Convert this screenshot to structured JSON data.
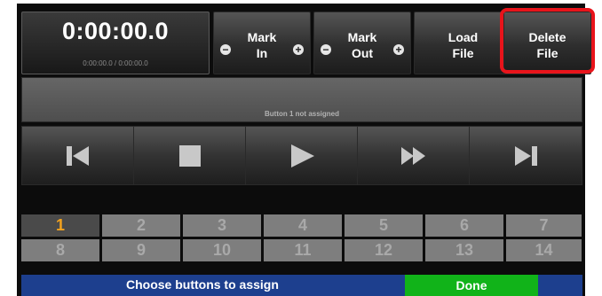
{
  "timer": {
    "main": "0:00:00.0",
    "sub": "0:00:00.0 / 0:00:00.0"
  },
  "buttons": {
    "mark_in": {
      "line1": "Mark",
      "line2": "In"
    },
    "mark_out": {
      "line1": "Mark",
      "line2": "Out"
    },
    "load_file": {
      "line1": "Load",
      "line2": "File"
    },
    "delete_file": {
      "line1": "Delete",
      "line2": "File"
    }
  },
  "assign_bar": {
    "text": "Button 1 not assigned"
  },
  "transport": [
    "skip-back-icon",
    "stop-icon",
    "play-icon",
    "fast-forward-icon",
    "skip-forward-icon"
  ],
  "grid": {
    "row1": [
      "1",
      "2",
      "3",
      "4",
      "5",
      "6",
      "7"
    ],
    "row2": [
      "8",
      "9",
      "10",
      "11",
      "12",
      "13",
      "14"
    ],
    "selected": "1"
  },
  "footer": {
    "prompt": "Choose buttons to assign",
    "done_label": "Done"
  },
  "colors": {
    "selected_number": "#f2a21e",
    "footer_bar": "#1d3f8e",
    "done_button": "#11b319",
    "highlight": "#e8141b"
  }
}
